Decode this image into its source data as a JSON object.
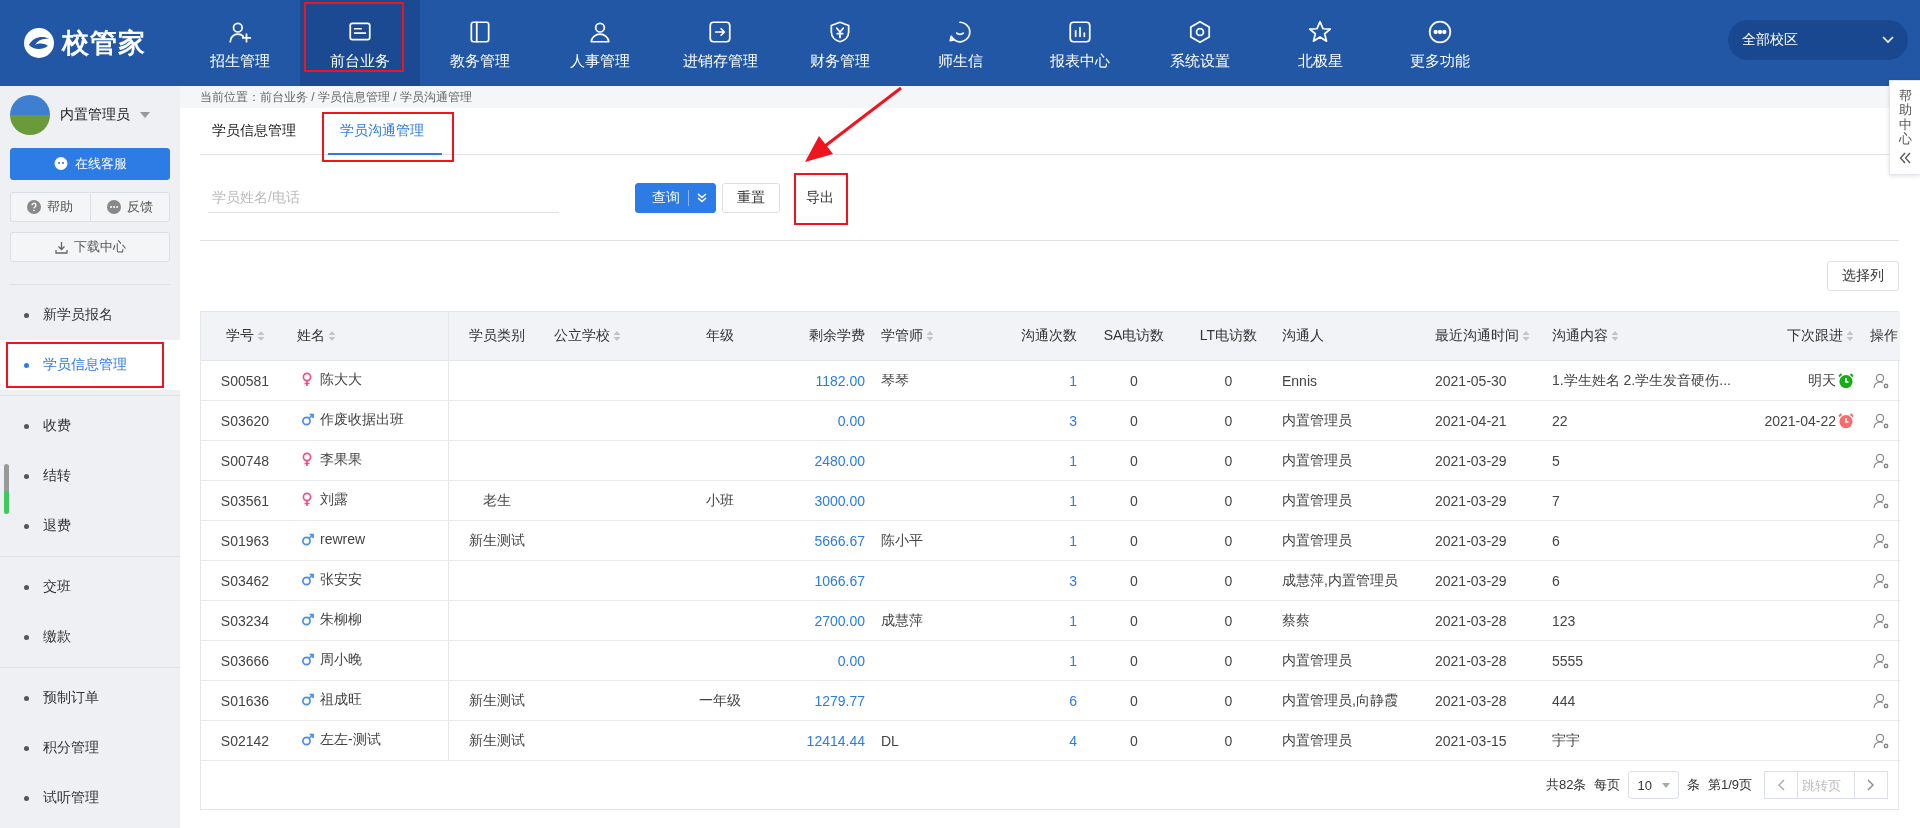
{
  "brand": {
    "name": "校管家"
  },
  "top_nav": [
    {
      "label": "招生管理",
      "selected": false,
      "highlighted": false
    },
    {
      "label": "前台业务",
      "selected": true,
      "highlighted": true
    },
    {
      "label": "教务管理",
      "selected": false,
      "highlighted": false
    },
    {
      "label": "人事管理",
      "selected": false,
      "highlighted": false
    },
    {
      "label": "进销存管理",
      "selected": false,
      "highlighted": false
    },
    {
      "label": "财务管理",
      "selected": false,
      "highlighted": false
    },
    {
      "label": "师生信",
      "selected": false,
      "highlighted": false
    },
    {
      "label": "报表中心",
      "selected": false,
      "highlighted": false
    },
    {
      "label": "系统设置",
      "selected": false,
      "highlighted": false
    },
    {
      "label": "北极星",
      "selected": false,
      "highlighted": false
    },
    {
      "label": "更多功能",
      "selected": false,
      "highlighted": false
    }
  ],
  "campus_select": {
    "value": "全部校区"
  },
  "sidebar": {
    "user_name": "内置管理员",
    "service_button": "在线客服",
    "help_button": "帮助",
    "feedback_button": "反馈",
    "download_button": "下载中心",
    "groups": [
      {
        "items": [
          {
            "label": "新学员报名",
            "selected": false,
            "highlighted": false
          },
          {
            "label": "学员信息管理",
            "selected": true,
            "highlighted": true
          }
        ]
      },
      {
        "items": [
          {
            "label": "收费",
            "selected": false,
            "highlighted": false
          },
          {
            "label": "结转",
            "selected": false,
            "highlighted": false
          },
          {
            "label": "退费",
            "selected": false,
            "highlighted": false
          }
        ]
      },
      {
        "items": [
          {
            "label": "交班",
            "selected": false,
            "highlighted": false
          },
          {
            "label": "缴款",
            "selected": false,
            "highlighted": false
          }
        ]
      },
      {
        "items": [
          {
            "label": "预制订单",
            "selected": false,
            "highlighted": false
          },
          {
            "label": "积分管理",
            "selected": false,
            "highlighted": false
          },
          {
            "label": "试听管理",
            "selected": false,
            "highlighted": false
          }
        ]
      }
    ]
  },
  "breadcrumb": "当前位置：前台业务 / 学员信息管理 / 学员沟通管理",
  "tabs": [
    {
      "label": "学员信息管理",
      "selected": false,
      "highlighted": false
    },
    {
      "label": "学员沟通管理",
      "selected": true,
      "highlighted": true
    }
  ],
  "search": {
    "placeholder": "学员姓名/电话"
  },
  "buttons": [
    {
      "kind": "query",
      "label": "查询",
      "highlighted": false
    },
    {
      "kind": "reset",
      "label": "重置",
      "highlighted": false
    },
    {
      "kind": "export",
      "label": "导出",
      "highlighted": true
    }
  ],
  "annotation_arrow": true,
  "column_picker": "选择列",
  "help_center": {
    "label": "帮助中心"
  },
  "table": {
    "columns": [
      {
        "label": "学号",
        "sortable": true
      },
      {
        "label": "姓名",
        "sortable": true
      },
      {
        "label": "学员类别",
        "sortable": false
      },
      {
        "label": "公立学校",
        "sortable": true
      },
      {
        "label": "年级",
        "sortable": false
      },
      {
        "label": "剩余学费",
        "sortable": false
      },
      {
        "label": "学管师",
        "sortable": true
      },
      {
        "label": "沟通次数",
        "sortable": false
      },
      {
        "label": "SA电访数",
        "sortable": false
      },
      {
        "label": "LT电访数",
        "sortable": false
      },
      {
        "label": "沟通人",
        "sortable": false
      },
      {
        "label": "最近沟通时间",
        "sortable": true
      },
      {
        "label": "沟通内容",
        "sortable": true
      },
      {
        "label": "下次跟进",
        "sortable": true
      },
      {
        "label": "操作",
        "sortable": false
      }
    ],
    "rows": [
      {
        "id": "S00581",
        "kind": "female",
        "name": "陈大大",
        "balance": "1182.00",
        "manager": "琴琴",
        "count": "1",
        "sa_calls": "0",
        "lt_calls": "0",
        "contact_person": "Ennis",
        "last_time": "2021-05-30",
        "content": "1.学生姓名 2.学生发音硬伤...",
        "next_follow": {
          "text": "明天",
          "color": "#1aad19"
        }
      },
      {
        "id": "S03620",
        "kind": "male",
        "name": "作废收据出班",
        "balance": "0.00",
        "count": "3",
        "sa_calls": "0",
        "lt_calls": "0",
        "contact_person": "内置管理员",
        "last_time": "2021-04-21",
        "content": "22",
        "next_follow": {
          "text": "2021-04-22",
          "color": "#f56c6c"
        }
      },
      {
        "id": "S00748",
        "kind": "female",
        "name": "李果果",
        "balance": "2480.00",
        "count": "1",
        "sa_calls": "0",
        "lt_calls": "0",
        "contact_person": "内置管理员",
        "last_time": "2021-03-29",
        "content": "5"
      },
      {
        "id": "S03561",
        "kind": "female",
        "name": "刘露",
        "category": "老生",
        "grade": "小班",
        "balance": "3000.00",
        "count": "1",
        "sa_calls": "0",
        "lt_calls": "0",
        "contact_person": "内置管理员",
        "last_time": "2021-03-29",
        "content": "7"
      },
      {
        "id": "S01963",
        "kind": "male",
        "name": "rewrew",
        "category": "新生测试",
        "balance": "5666.67",
        "manager": "陈小平",
        "count": "1",
        "sa_calls": "0",
        "lt_calls": "0",
        "contact_person": "内置管理员",
        "last_time": "2021-03-29",
        "content": "6"
      },
      {
        "id": "S03462",
        "kind": "male",
        "name": "张安安",
        "balance": "1066.67",
        "count": "3",
        "sa_calls": "0",
        "lt_calls": "0",
        "contact_person": "成慧萍,内置管理员",
        "last_time": "2021-03-29",
        "content": "6"
      },
      {
        "id": "S03234",
        "kind": "male",
        "name": "朱柳柳",
        "balance": "2700.00",
        "manager": "成慧萍",
        "count": "1",
        "sa_calls": "0",
        "lt_calls": "0",
        "contact_person": "蔡蔡",
        "last_time": "2021-03-28",
        "content": "123"
      },
      {
        "id": "S03666",
        "kind": "male",
        "name": "周小晚",
        "balance": "0.00",
        "count": "1",
        "sa_calls": "0",
        "lt_calls": "0",
        "contact_person": "内置管理员",
        "last_time": "2021-03-28",
        "content": "5555"
      },
      {
        "id": "S01636",
        "kind": "male",
        "name": "祖成旺",
        "category": "新生测试",
        "grade": "一年级",
        "balance": "1279.77",
        "count": "6",
        "sa_calls": "0",
        "lt_calls": "0",
        "contact_person": "内置管理员,向静霞",
        "last_time": "2021-03-28",
        "content": "444"
      },
      {
        "id": "S02142",
        "kind": "male",
        "name": "左左-测试",
        "category": "新生测试",
        "balance": "12414.44",
        "manager": "DL",
        "count": "4",
        "sa_calls": "0",
        "lt_calls": "0",
        "contact_person": "内置管理员",
        "last_time": "2021-03-15",
        "content": "宇宇"
      }
    ]
  },
  "pagination": {
    "total": "共82条",
    "per_page_label": "每页",
    "per_page": "10",
    "unit": "条",
    "page": "第1/9页",
    "jump_placeholder": "跳转页"
  }
}
